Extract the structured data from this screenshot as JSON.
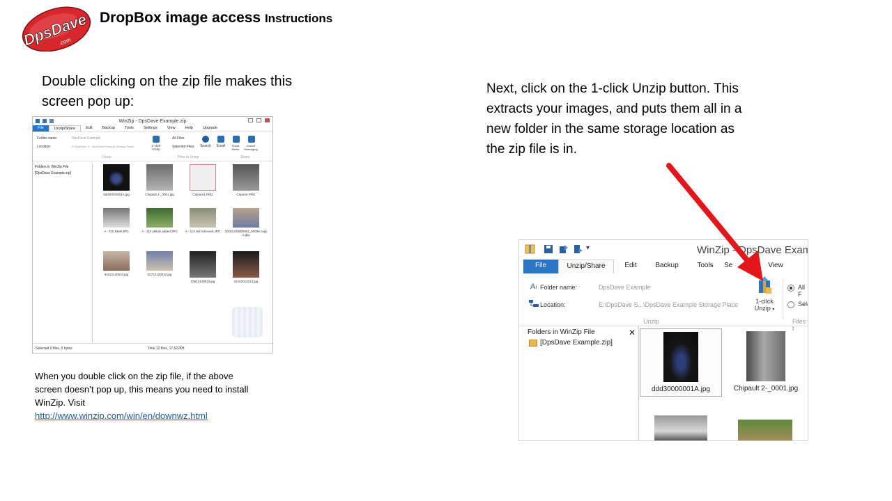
{
  "header": {
    "logo_text": "DpsDave",
    "logo_sub": ".com",
    "title_main": "DropBox image access",
    "title_small": "Instructions"
  },
  "left": {
    "intro": "Double clicking on the zip file makes this screen pop up:",
    "note": "When you double click on the zip file, if the above screen doesn’t pop up, this means you need to install WinZip.  Visit",
    "link": "http://www.winzip.com/win/en/downwz.html"
  },
  "right": {
    "text": "Next, click on the 1-click Unzip button.  This extracts your images, and puts them all in a new folder in the same storage location as the zip file is in."
  },
  "mini_window": {
    "title": "WinZip - DpsDave Example.zip",
    "tabs": [
      "File",
      "Unzip/Share",
      "Edit",
      "Backup",
      "Tools",
      "Settings",
      "View",
      "Help",
      "Upgrade"
    ],
    "folder_name_label": "Folder name:",
    "folder_name_value": "DpsDave Example",
    "location_label": "Location:",
    "location_value": "E:\\DpsDave S...\\DpsDave Example Storage Place",
    "unzip_button": "1-click Unzip",
    "all_files": "All Files",
    "selected_files": "Selected Files",
    "search": "Search",
    "email": "Email",
    "social_media": "Social Media",
    "instant_messaging": "Instant Messaging",
    "group_unzip": "Unzip",
    "group_files_to_unzip": "Files to Unzip",
    "group_share": "Share",
    "side_header": "Folders in WinZip File",
    "side_folder": "[DpsDave Example.zip]",
    "files": [
      "ddd30000001A.jpg",
      "Chipault 2-_0001.jpg",
      "Capture1.PNG",
      "Capture.PNG",
      "A - 310 B&W.JPG",
      "A - 113 yellow added.JPG",
      "A - 113 red removed.JPG",
      "20101220000001_00009 copy 2.jpg",
      "02012120010.jpg",
      "02712120010.jpg",
      "03812120010.jpg",
      "02102012013.jpg"
    ],
    "status_left": "Selected 0 files, 0 bytes",
    "status_total": "Total 12 files, 17,622KB"
  },
  "zoom_window": {
    "title": "WinZip - DpsDave Example",
    "tabs": [
      "File",
      "Unzip/Share",
      "Edit",
      "Backup",
      "Tools",
      "Se",
      "View"
    ],
    "folder_name_label": "Folder name:",
    "folder_name_value": "DpsDave Example",
    "location_label": "Location:",
    "location_value": "E:\\DpsDave S...\\DpsDave Example Storage Place",
    "unzip_line1": "1-click",
    "unzip_line2": "Unzip",
    "all_label": "All F",
    "sel_label": "Sele",
    "group_unzip": "Unzip",
    "group_files": "Files t",
    "side_header": "Folders in WinZip File",
    "side_close": "✕",
    "side_folder": "[DpsDave Example.zip]",
    "file1": "ddd30000001A.jpg",
    "file2": "Chipault 2-_0001.jpg"
  },
  "colors": {
    "logo_red": "#d8262d",
    "winzip_blue": "#2b73c5",
    "arrow_red": "#e3161c",
    "link_blue": "#1f5ea8"
  }
}
